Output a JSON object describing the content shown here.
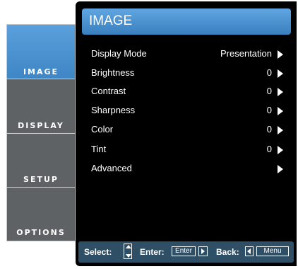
{
  "tabs": [
    {
      "label": "IMAGE",
      "active": true
    },
    {
      "label": "DISPLAY",
      "active": false
    },
    {
      "label": "SETUP",
      "active": false
    },
    {
      "label": "OPTIONS",
      "active": false
    }
  ],
  "header": {
    "title": "IMAGE"
  },
  "menu": [
    {
      "label": "Display Mode",
      "value": "Presentation"
    },
    {
      "label": "Brightness",
      "value": "0"
    },
    {
      "label": "Contrast",
      "value": "0"
    },
    {
      "label": "Sharpness",
      "value": "0"
    },
    {
      "label": "Color",
      "value": "0"
    },
    {
      "label": "Tint",
      "value": "0"
    },
    {
      "label": "Advanced",
      "value": ""
    }
  ],
  "help": {
    "select_label": "Select:",
    "enter_label": "Enter:",
    "enter_key": "Enter",
    "back_label": "Back:",
    "menu_key": "Menu"
  },
  "colors": {
    "accent": "#4a92d2",
    "panel": "#000000",
    "tab_bg": "#5f6264",
    "helpbar": "#2f4f66"
  },
  "icons": [
    "arrow-right-icon",
    "up-down-arrow-icon",
    "left-arrow-icon"
  ]
}
